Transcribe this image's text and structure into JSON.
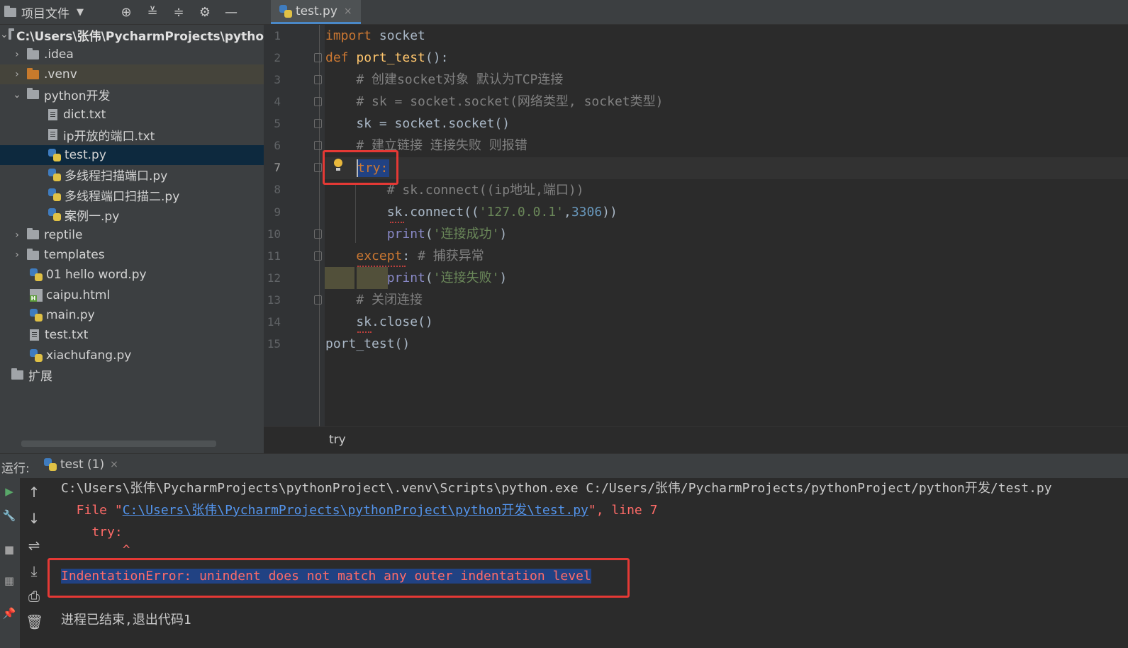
{
  "project": {
    "title": "项目文件",
    "root_path": "C:\\Users\\张伟\\PycharmProjects\\pytho",
    "items": [
      {
        "label": ".idea",
        "kind": "folder",
        "arrow": "›"
      },
      {
        "label": ".venv",
        "kind": "folder-orange",
        "arrow": "›"
      },
      {
        "label": "python开发",
        "kind": "folder",
        "arrow": "⌄"
      },
      {
        "label": "dict.txt",
        "kind": "file"
      },
      {
        "label": "ip开放的端口.txt",
        "kind": "file"
      },
      {
        "label": "test.py",
        "kind": "py"
      },
      {
        "label": "多线程扫描端口.py",
        "kind": "py"
      },
      {
        "label": "多线程端口扫描二.py",
        "kind": "py"
      },
      {
        "label": "案例一.py",
        "kind": "py"
      },
      {
        "label": "reptile",
        "kind": "folder",
        "arrow": "›"
      },
      {
        "label": "templates",
        "kind": "folder",
        "arrow": "›"
      },
      {
        "label": "01 hello word.py",
        "kind": "py"
      },
      {
        "label": "caipu.html",
        "kind": "html"
      },
      {
        "label": "main.py",
        "kind": "py"
      },
      {
        "label": "test.txt",
        "kind": "file"
      },
      {
        "label": "xiachufang.py",
        "kind": "py"
      },
      {
        "label": "扩展",
        "kind": "folder"
      }
    ]
  },
  "editor": {
    "tab_label": "test.py",
    "tab_close": "×",
    "line_numbers": [
      "1",
      "2",
      "3",
      "4",
      "5",
      "6",
      "7",
      "8",
      "9",
      "10",
      "11",
      "12",
      "13",
      "14",
      "15"
    ],
    "code": {
      "l1": {
        "kw": "import",
        "rest": " socket"
      },
      "l2": {
        "kw": "def",
        "fn": " port_test",
        "rest": "():"
      },
      "l3": "    # 创建socket对象 默认为TCP连接",
      "l4": "    # sk = socket.socket(网络类型, socket类型)",
      "l5": "    sk = socket.socket()",
      "l6": "    # 建立链接 连接失败 则报错",
      "l7": "try:",
      "l8": "        # sk.connect((ip地址,端口))",
      "l9": {
        "a": "        sk.connect((",
        "s": "'127.0.0.1'",
        "b": ",",
        "n": "3306",
        "c": "))"
      },
      "l10": {
        "a": "        ",
        "bi": "print",
        "b": "(",
        "s": "'连接成功'",
        "c": ")"
      },
      "l11": {
        "a": "    ",
        "kw": "except",
        "b": ": ",
        "cm": "# 捕获异常"
      },
      "l12": {
        "a": "        ",
        "bi": "print",
        "b": "(",
        "s": "'连接失败'",
        "c": ")"
      },
      "l13": "    # 关闭连接",
      "l14": "    sk.close()",
      "l15": "port_test()"
    },
    "breadcrumb": "try"
  },
  "run": {
    "label": "运行:",
    "tab_label": "test (1)",
    "tab_close": "×",
    "cmd_line": "C:\\Users\\张伟\\PycharmProjects\\pythonProject\\.venv\\Scripts\\python.exe C:/Users/张伟/PycharmProjects/pythonProject/python开发/test.py",
    "file_prefix": "  File \"",
    "file_link": "C:\\Users\\张伟\\PycharmProjects\\pythonProject\\python开发\\test.py",
    "file_suffix": "\", line 7",
    "try_line": "    try:",
    "caret_line": "        ^",
    "error": "IndentationError: unindent does not match any outer indentation level",
    "finish": "进程已结束,退出代码1"
  },
  "colors": {
    "keyword": "#cc7832",
    "function": "#ffc66d",
    "comment": "#808080",
    "string": "#6a8759",
    "number": "#6897bb",
    "error": "#ff6b68",
    "highlight_box": "#e53935"
  }
}
